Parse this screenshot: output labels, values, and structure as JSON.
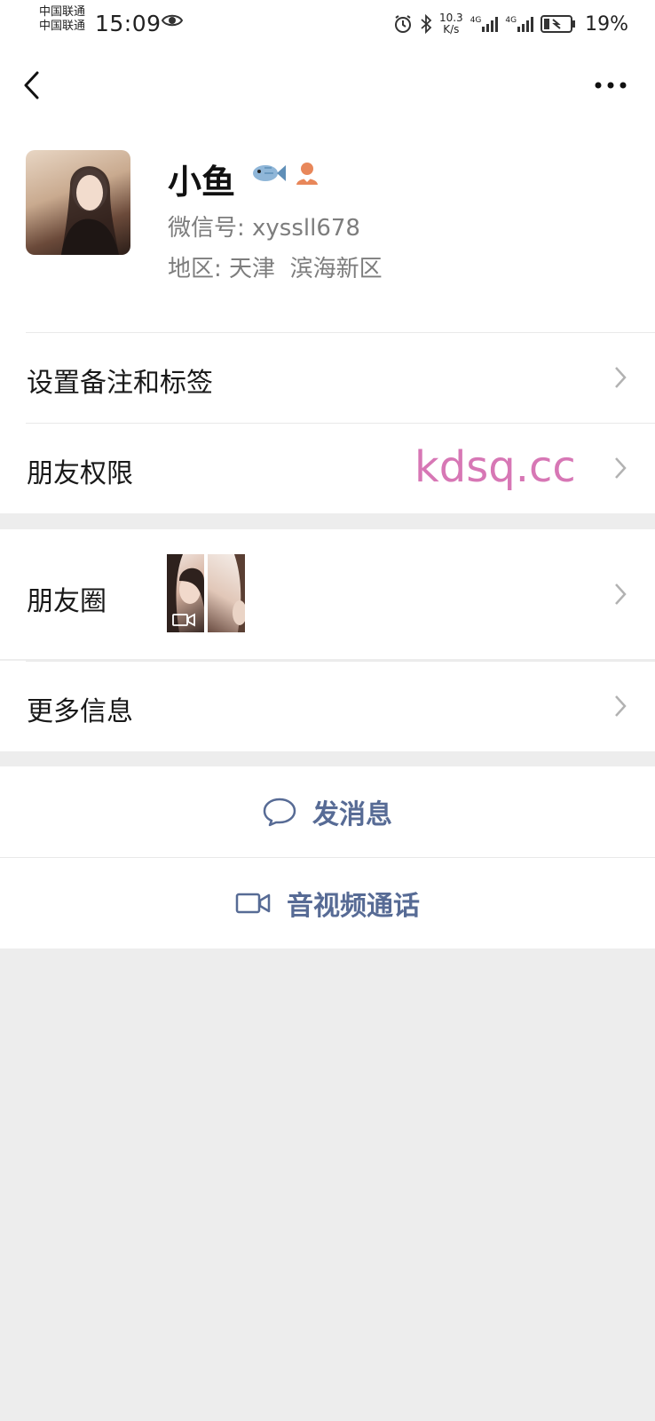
{
  "status_bar": {
    "carrier_1": "中国联通",
    "carrier_2": "中国联通",
    "time": "15:09",
    "net_speed_value": "10.3",
    "net_speed_unit": "K/s",
    "signal_1": "4G",
    "signal_2": "4G",
    "battery": "19%"
  },
  "profile": {
    "name": "小鱼",
    "wechat_id_label": "微信号:",
    "wechat_id": "xyssll678",
    "region_label": "地区:",
    "region_city": "天津",
    "region_district": "滨海新区",
    "badges": [
      "fish-icon",
      "avatar-status-icon"
    ]
  },
  "menu": {
    "remarks_tags": "设置备注和标签",
    "friend_permissions": "朋友权限",
    "moments": "朋友圈",
    "more_info": "更多信息"
  },
  "watermark": "kdsq.cc",
  "actions": {
    "send_message": "发消息",
    "video_call": "音视频通话"
  },
  "colors": {
    "link_blue": "#576b95",
    "background_gray": "#ededed",
    "watermark_pink": "#d777b5"
  }
}
